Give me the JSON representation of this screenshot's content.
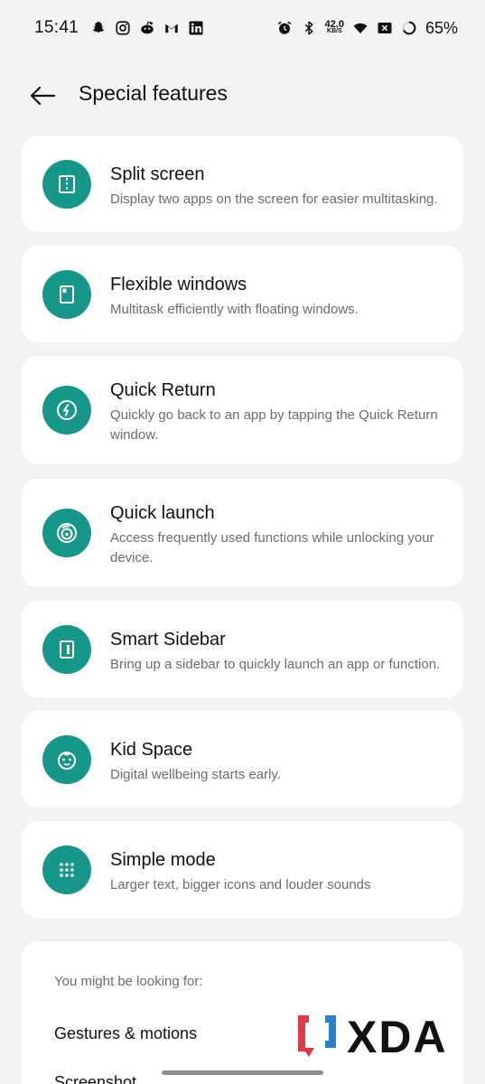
{
  "status_bar": {
    "time": "15:41",
    "left_icons": [
      "snapchat-icon",
      "instagram-icon",
      "reddit-icon",
      "gmail-icon",
      "linkedin-icon"
    ],
    "right_icons": [
      "alarm-icon",
      "bluetooth-icon",
      "wifi-icon",
      "no-sim-icon",
      "battery-ring-icon"
    ],
    "net_speed_value": "42.0",
    "net_speed_unit": "KB/S",
    "battery_percent": "65%"
  },
  "header": {
    "title": "Special features"
  },
  "features": [
    {
      "title": "Split screen",
      "description": "Display two apps on the screen for easier multitasking.",
      "icon": "split-screen-icon"
    },
    {
      "title": "Flexible windows",
      "description": "Multitask efficiently with floating windows.",
      "icon": "flexible-windows-icon"
    },
    {
      "title": "Quick Return",
      "description": "Quickly go back to an app by tapping the Quick Return window.",
      "icon": "quick-return-icon"
    },
    {
      "title": "Quick launch",
      "description": "Access frequently used functions while unlocking your device.",
      "icon": "quick-launch-icon"
    },
    {
      "title": "Smart Sidebar",
      "description": "Bring up a sidebar to quickly launch an app or function.",
      "icon": "smart-sidebar-icon"
    },
    {
      "title": "Kid Space",
      "description": "Digital wellbeing starts early.",
      "icon": "kid-space-icon"
    },
    {
      "title": "Simple mode",
      "description": "Larger text, bigger icons and louder sounds",
      "icon": "simple-mode-icon"
    }
  ],
  "suggestions": {
    "heading": "You might be looking for:",
    "items": [
      "Gestures & motions",
      "Screenshot"
    ]
  },
  "watermark": {
    "text": "XDA"
  },
  "colors": {
    "accent": "#17968a",
    "background": "#f3f3f5",
    "card": "#ffffff",
    "secondary_text": "#6c6c6c"
  }
}
